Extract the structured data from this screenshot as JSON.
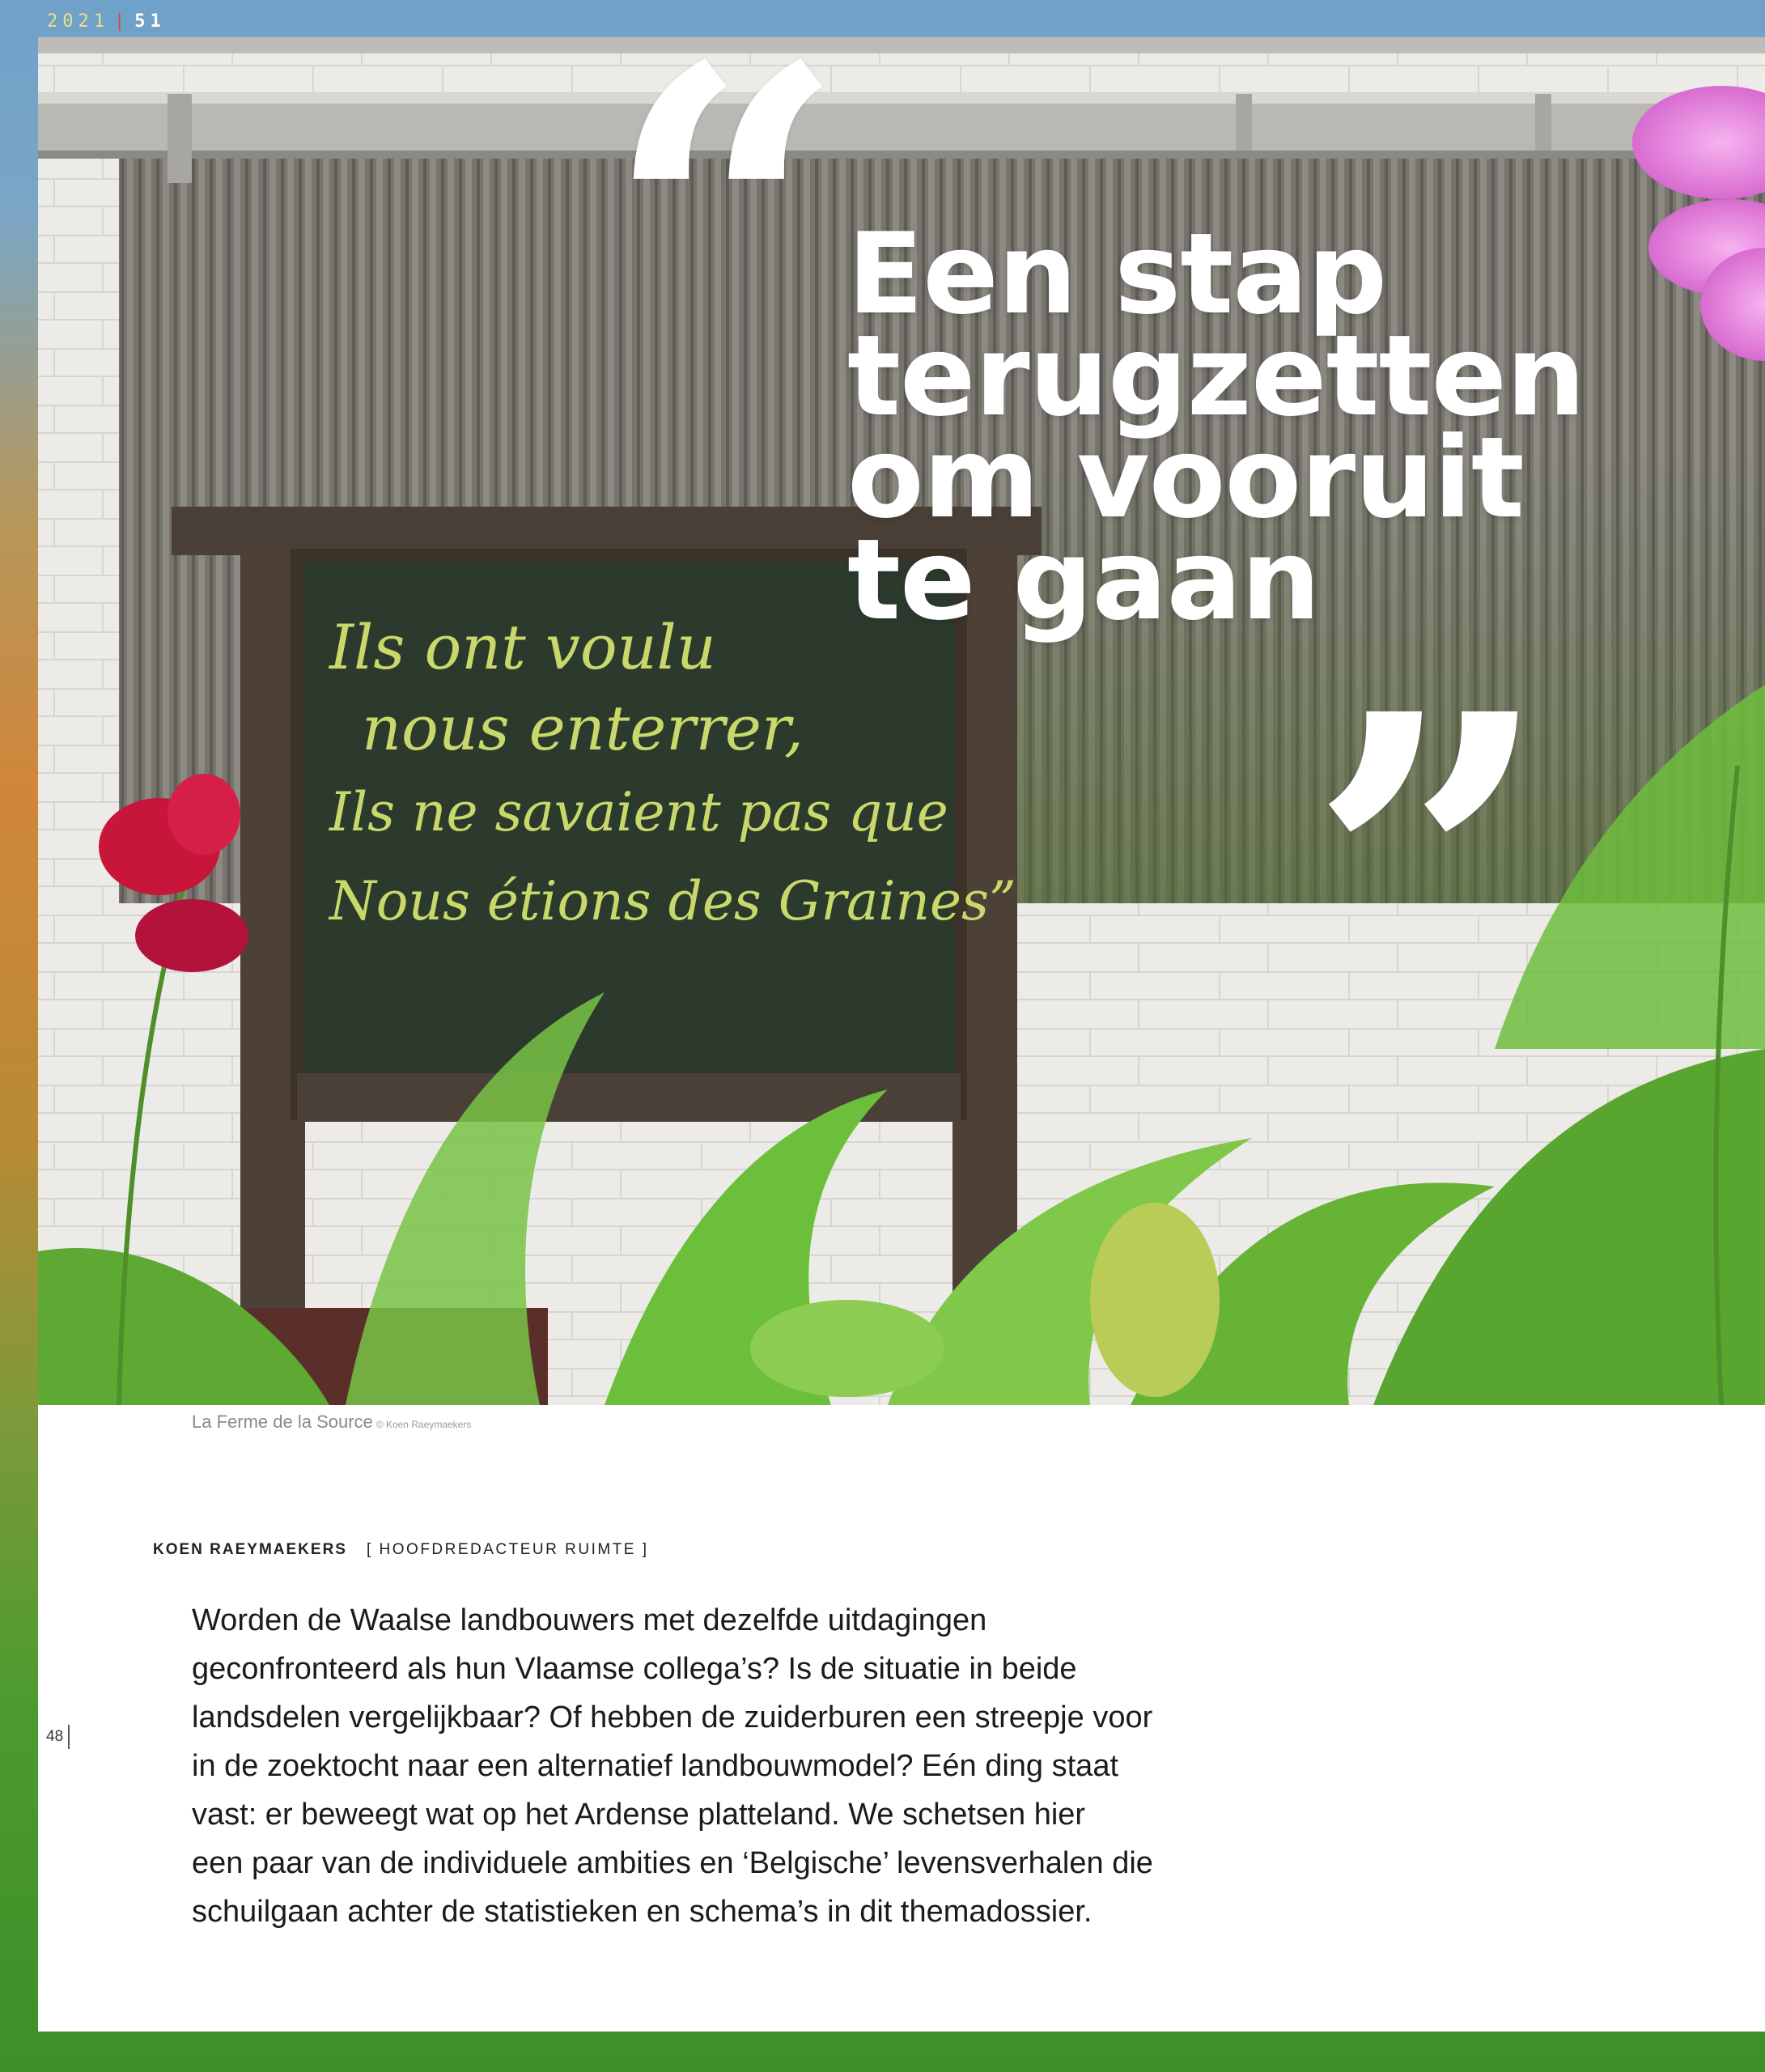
{
  "header": {
    "year": "2021",
    "issue": "51"
  },
  "quote": {
    "open_mark": "“",
    "close_mark": "”",
    "lines": [
      "Een stap",
      "terugzetten",
      "om vooruit",
      "te gaan"
    ]
  },
  "photo": {
    "chalkboard_lines": [
      "Ils ont voulu",
      "nous enterrer,",
      "Ils ne savaient pas que",
      "Nous étions des Graines”"
    ],
    "caption": "La Ferme de la Source",
    "credit": "© Koen Raeymaekers"
  },
  "article": {
    "author": "KOEN RAEYMAEKERS",
    "role": "[ HOOFDREDACTEUR RUIMTE ]",
    "intro_lines": [
      "Worden de Waalse landbouwers met dezelfde uitdagingen",
      "geconfronteerd als hun Vlaamse collega’s? Is de situatie in beide",
      "landsdelen vergelijkbaar? Of hebben de zuiderburen een streepje voor",
      "in de zoektocht naar een alternatief landbouwmodel? Eén ding staat",
      "vast: er beweegt wat op het Ardense platteland. We schetsen hier",
      "een paar van de individuele ambities en ‘Belgische’ levensverhalen die",
      "schuilgaan achter de statistieken en schema’s in dit themadossier."
    ]
  },
  "page_number": "48",
  "colors": {
    "chalk": "#c9d86a",
    "board": "#2c3a2e",
    "accent": "#d24b3a"
  }
}
